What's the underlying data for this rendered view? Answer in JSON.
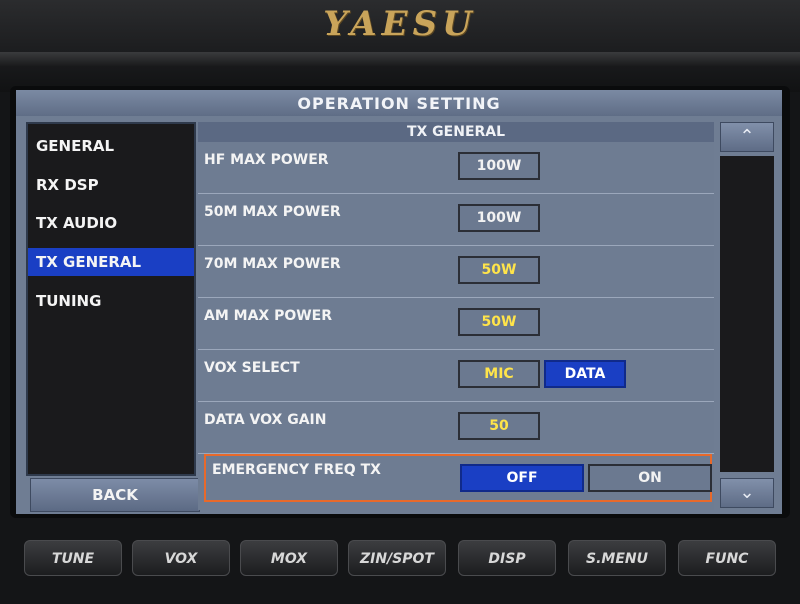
{
  "brand": "YAESU",
  "window": {
    "title": "OPERATION SETTING"
  },
  "sidebar": {
    "items": [
      {
        "label": "GENERAL",
        "active": false
      },
      {
        "label": "RX DSP",
        "active": false
      },
      {
        "label": "TX AUDIO",
        "active": false
      },
      {
        "label": "TX GENERAL",
        "active": true
      },
      {
        "label": "TUNING",
        "active": false
      }
    ],
    "back_label": "BACK"
  },
  "panel": {
    "header": "TX GENERAL",
    "rows": [
      {
        "label": "HF MAX POWER",
        "value": "100W"
      },
      {
        "label": "50M MAX POWER",
        "value": "100W"
      },
      {
        "label": "70M MAX POWER",
        "value": "50W"
      },
      {
        "label": "AM MAX POWER",
        "value": "50W"
      },
      {
        "label": "VOX SELECT",
        "options": [
          "MIC",
          "DATA"
        ],
        "selected": "DATA"
      },
      {
        "label": "DATA VOX GAIN",
        "value": "50"
      },
      {
        "label": "EMERGENCY FREQ TX",
        "options": [
          "OFF",
          "ON"
        ],
        "selected": "OFF"
      }
    ]
  },
  "scrollbar": {
    "up_icon": "chevron-up-icon",
    "down_icon": "chevron-down-icon"
  },
  "hard_buttons": [
    "TUNE",
    "VOX",
    "MOX",
    "ZIN/SPOT",
    "DISP",
    "S.MENU",
    "FUNC"
  ],
  "colors": {
    "screen_bg": "#6f7d93",
    "selected_blue": "#1a3fc4",
    "value_yellow": "#ffe44a",
    "highlight_orange": "#e8692a",
    "brand_gold": "#c9a45a"
  }
}
